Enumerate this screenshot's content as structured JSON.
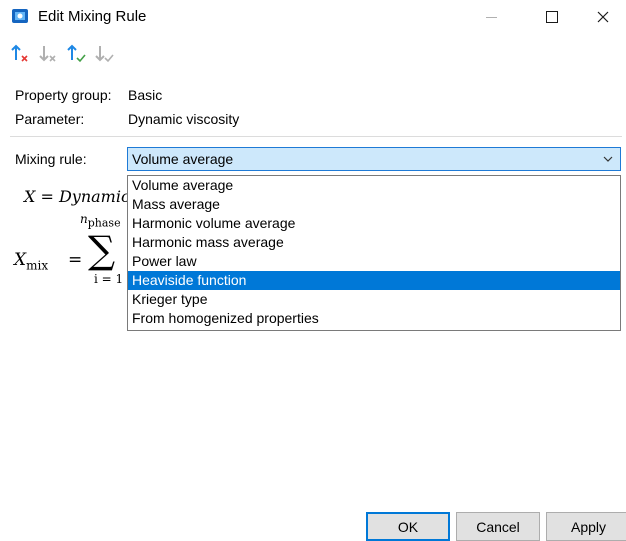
{
  "window": {
    "title": "Edit Mixing Rule",
    "controls": [
      "minimize-icon",
      "maximize-icon",
      "close-icon"
    ]
  },
  "toolbar": {
    "buttons": [
      {
        "name": "move-up-remove",
        "icon": "arrow-up-x-icon",
        "color": "#1e88e5",
        "badge_color": "#e53935"
      },
      {
        "name": "move-down-remove",
        "icon": "arrow-down-x-icon",
        "color": "#b0b0b0",
        "badge_color": "#b0b0b0"
      },
      {
        "name": "move-up-check",
        "icon": "arrow-up-check-icon",
        "color": "#1e88e5",
        "badge_color": "#43a047"
      },
      {
        "name": "move-down-check",
        "icon": "arrow-down-check-icon",
        "color": "#b0b0b0",
        "badge_color": "#b0b0b0"
      }
    ]
  },
  "info": {
    "property_group_label": "Property group:",
    "property_group_value": "Basic",
    "parameter_label": "Parameter:",
    "parameter_value": "Dynamic viscosity"
  },
  "mixing": {
    "label": "Mixing rule:",
    "selected": "Volume average",
    "options": [
      "Volume average",
      "Mass average",
      "Harmonic volume average",
      "Harmonic mass average",
      "Power law",
      "Heaviside function",
      "Krieger type",
      "From homogenized properties"
    ],
    "highlighted_option": "Heaviside function"
  },
  "formula": {
    "x_def": "X = Dynamic",
    "sum_upper": "n",
    "sum_upper_sub": "phase",
    "sum_lower": "i = 1",
    "x_mix": "X",
    "x_mix_sub": "mix",
    "equals": "=",
    "sigma": "∑"
  },
  "buttons": {
    "ok": "OK",
    "cancel": "Cancel",
    "apply": "Apply"
  },
  "colors": {
    "accent": "#0078d7",
    "combo_bg": "#cde8fb"
  }
}
